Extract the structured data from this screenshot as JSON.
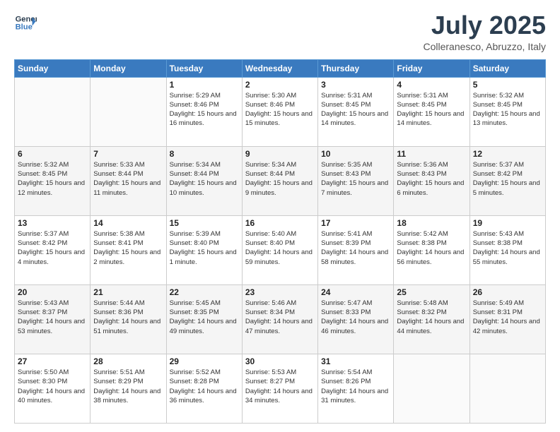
{
  "header": {
    "logo_line1": "General",
    "logo_line2": "Blue",
    "month_year": "July 2025",
    "location": "Colleranesco, Abruzzo, Italy"
  },
  "weekdays": [
    "Sunday",
    "Monday",
    "Tuesday",
    "Wednesday",
    "Thursday",
    "Friday",
    "Saturday"
  ],
  "weeks": [
    [
      {
        "day": "",
        "sunrise": "",
        "sunset": "",
        "daylight": ""
      },
      {
        "day": "",
        "sunrise": "",
        "sunset": "",
        "daylight": ""
      },
      {
        "day": "1",
        "sunrise": "Sunrise: 5:29 AM",
        "sunset": "Sunset: 8:46 PM",
        "daylight": "Daylight: 15 hours and 16 minutes."
      },
      {
        "day": "2",
        "sunrise": "Sunrise: 5:30 AM",
        "sunset": "Sunset: 8:46 PM",
        "daylight": "Daylight: 15 hours and 15 minutes."
      },
      {
        "day": "3",
        "sunrise": "Sunrise: 5:31 AM",
        "sunset": "Sunset: 8:45 PM",
        "daylight": "Daylight: 15 hours and 14 minutes."
      },
      {
        "day": "4",
        "sunrise": "Sunrise: 5:31 AM",
        "sunset": "Sunset: 8:45 PM",
        "daylight": "Daylight: 15 hours and 14 minutes."
      },
      {
        "day": "5",
        "sunrise": "Sunrise: 5:32 AM",
        "sunset": "Sunset: 8:45 PM",
        "daylight": "Daylight: 15 hours and 13 minutes."
      }
    ],
    [
      {
        "day": "6",
        "sunrise": "Sunrise: 5:32 AM",
        "sunset": "Sunset: 8:45 PM",
        "daylight": "Daylight: 15 hours and 12 minutes."
      },
      {
        "day": "7",
        "sunrise": "Sunrise: 5:33 AM",
        "sunset": "Sunset: 8:44 PM",
        "daylight": "Daylight: 15 hours and 11 minutes."
      },
      {
        "day": "8",
        "sunrise": "Sunrise: 5:34 AM",
        "sunset": "Sunset: 8:44 PM",
        "daylight": "Daylight: 15 hours and 10 minutes."
      },
      {
        "day": "9",
        "sunrise": "Sunrise: 5:34 AM",
        "sunset": "Sunset: 8:44 PM",
        "daylight": "Daylight: 15 hours and 9 minutes."
      },
      {
        "day": "10",
        "sunrise": "Sunrise: 5:35 AM",
        "sunset": "Sunset: 8:43 PM",
        "daylight": "Daylight: 15 hours and 7 minutes."
      },
      {
        "day": "11",
        "sunrise": "Sunrise: 5:36 AM",
        "sunset": "Sunset: 8:43 PM",
        "daylight": "Daylight: 15 hours and 6 minutes."
      },
      {
        "day": "12",
        "sunrise": "Sunrise: 5:37 AM",
        "sunset": "Sunset: 8:42 PM",
        "daylight": "Daylight: 15 hours and 5 minutes."
      }
    ],
    [
      {
        "day": "13",
        "sunrise": "Sunrise: 5:37 AM",
        "sunset": "Sunset: 8:42 PM",
        "daylight": "Daylight: 15 hours and 4 minutes."
      },
      {
        "day": "14",
        "sunrise": "Sunrise: 5:38 AM",
        "sunset": "Sunset: 8:41 PM",
        "daylight": "Daylight: 15 hours and 2 minutes."
      },
      {
        "day": "15",
        "sunrise": "Sunrise: 5:39 AM",
        "sunset": "Sunset: 8:40 PM",
        "daylight": "Daylight: 15 hours and 1 minute."
      },
      {
        "day": "16",
        "sunrise": "Sunrise: 5:40 AM",
        "sunset": "Sunset: 8:40 PM",
        "daylight": "Daylight: 14 hours and 59 minutes."
      },
      {
        "day": "17",
        "sunrise": "Sunrise: 5:41 AM",
        "sunset": "Sunset: 8:39 PM",
        "daylight": "Daylight: 14 hours and 58 minutes."
      },
      {
        "day": "18",
        "sunrise": "Sunrise: 5:42 AM",
        "sunset": "Sunset: 8:38 PM",
        "daylight": "Daylight: 14 hours and 56 minutes."
      },
      {
        "day": "19",
        "sunrise": "Sunrise: 5:43 AM",
        "sunset": "Sunset: 8:38 PM",
        "daylight": "Daylight: 14 hours and 55 minutes."
      }
    ],
    [
      {
        "day": "20",
        "sunrise": "Sunrise: 5:43 AM",
        "sunset": "Sunset: 8:37 PM",
        "daylight": "Daylight: 14 hours and 53 minutes."
      },
      {
        "day": "21",
        "sunrise": "Sunrise: 5:44 AM",
        "sunset": "Sunset: 8:36 PM",
        "daylight": "Daylight: 14 hours and 51 minutes."
      },
      {
        "day": "22",
        "sunrise": "Sunrise: 5:45 AM",
        "sunset": "Sunset: 8:35 PM",
        "daylight": "Daylight: 14 hours and 49 minutes."
      },
      {
        "day": "23",
        "sunrise": "Sunrise: 5:46 AM",
        "sunset": "Sunset: 8:34 PM",
        "daylight": "Daylight: 14 hours and 47 minutes."
      },
      {
        "day": "24",
        "sunrise": "Sunrise: 5:47 AM",
        "sunset": "Sunset: 8:33 PM",
        "daylight": "Daylight: 14 hours and 46 minutes."
      },
      {
        "day": "25",
        "sunrise": "Sunrise: 5:48 AM",
        "sunset": "Sunset: 8:32 PM",
        "daylight": "Daylight: 14 hours and 44 minutes."
      },
      {
        "day": "26",
        "sunrise": "Sunrise: 5:49 AM",
        "sunset": "Sunset: 8:31 PM",
        "daylight": "Daylight: 14 hours and 42 minutes."
      }
    ],
    [
      {
        "day": "27",
        "sunrise": "Sunrise: 5:50 AM",
        "sunset": "Sunset: 8:30 PM",
        "daylight": "Daylight: 14 hours and 40 minutes."
      },
      {
        "day": "28",
        "sunrise": "Sunrise: 5:51 AM",
        "sunset": "Sunset: 8:29 PM",
        "daylight": "Daylight: 14 hours and 38 minutes."
      },
      {
        "day": "29",
        "sunrise": "Sunrise: 5:52 AM",
        "sunset": "Sunset: 8:28 PM",
        "daylight": "Daylight: 14 hours and 36 minutes."
      },
      {
        "day": "30",
        "sunrise": "Sunrise: 5:53 AM",
        "sunset": "Sunset: 8:27 PM",
        "daylight": "Daylight: 14 hours and 34 minutes."
      },
      {
        "day": "31",
        "sunrise": "Sunrise: 5:54 AM",
        "sunset": "Sunset: 8:26 PM",
        "daylight": "Daylight: 14 hours and 31 minutes."
      },
      {
        "day": "",
        "sunrise": "",
        "sunset": "",
        "daylight": ""
      },
      {
        "day": "",
        "sunrise": "",
        "sunset": "",
        "daylight": ""
      }
    ]
  ]
}
